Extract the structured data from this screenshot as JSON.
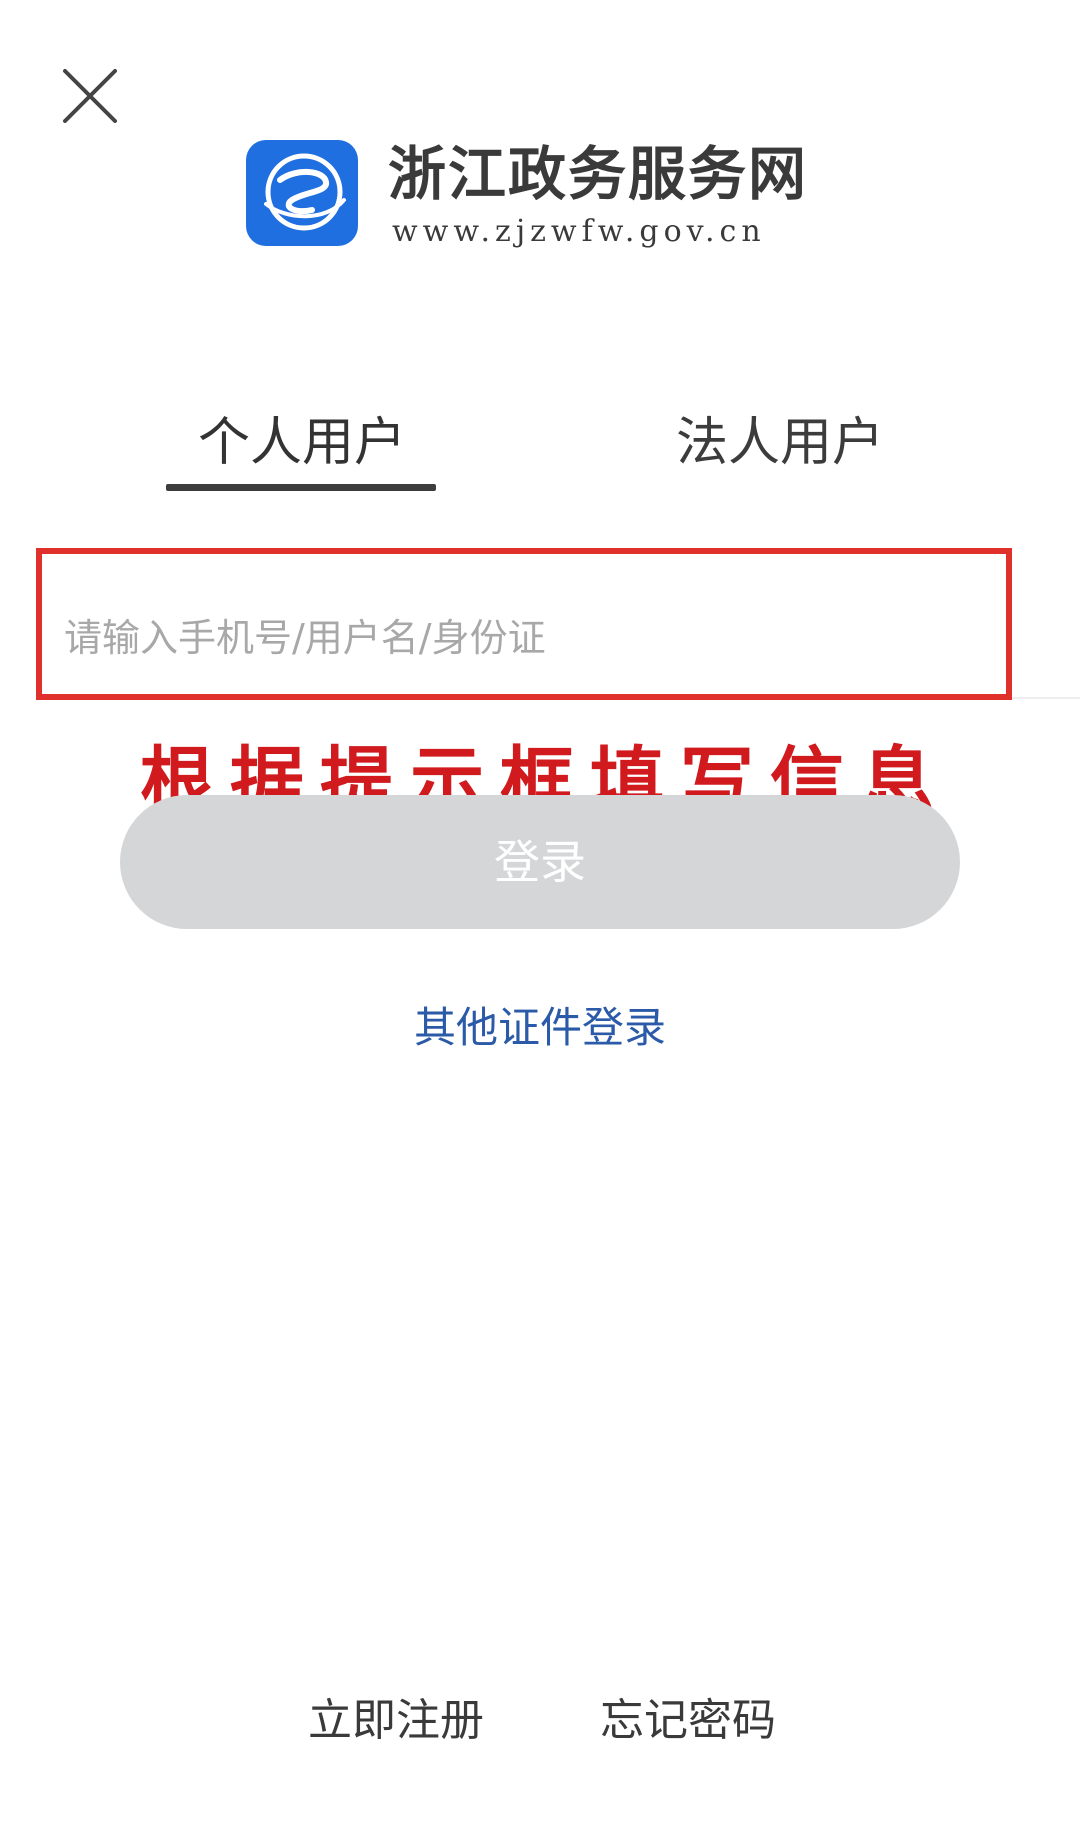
{
  "header": {
    "logo_icon": "zhejiang-gov-logo-icon",
    "title": "浙江政务服务网",
    "url": "www.zjzwfw.gov.cn"
  },
  "close_icon": "close-icon",
  "tabs": [
    {
      "label": "个人用户",
      "active": true
    },
    {
      "label": "法人用户",
      "active": false
    }
  ],
  "account_input": {
    "placeholder": "请输入手机号/用户名/身份证",
    "value": ""
  },
  "annotation": {
    "text": "根据提示框填写信息",
    "color": "#d01a1e"
  },
  "login_button": {
    "label": "登录",
    "background": "#d5d6d8"
  },
  "other_login_link": {
    "label": "其他证件登录",
    "color": "#2a5aa8"
  },
  "footer": {
    "register_label": "立即注册",
    "forgot_label": "忘记密码"
  }
}
